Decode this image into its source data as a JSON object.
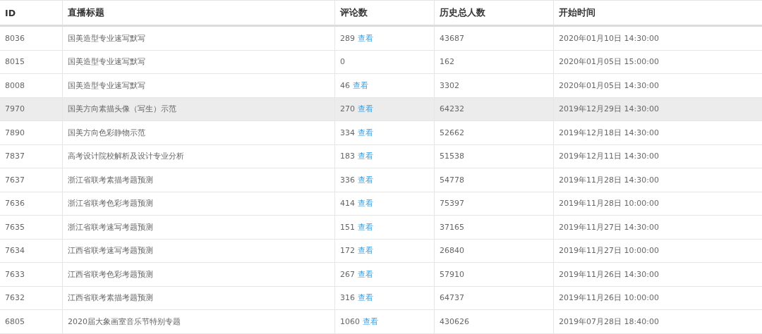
{
  "table": {
    "columns": [
      "ID",
      "直播标题",
      "评论数",
      "历史总人数",
      "开始时间"
    ],
    "rows": [
      {
        "id": "8036",
        "title": "国美造型专业速写默写",
        "comments": "289",
        "link": "查看",
        "viewers": "43687",
        "start": "2020年01月10日 14:30:00",
        "selected": false
      },
      {
        "id": "8015",
        "title": "国美造型专业速写默写",
        "comments": "0",
        "viewers": "162",
        "start": "2020年01月05日 15:00:00",
        "selected": false
      },
      {
        "id": "8008",
        "title": "国美造型专业速写默写",
        "comments": "46",
        "link": "查看",
        "viewers": "3302",
        "start": "2020年01月05日 14:30:00",
        "selected": false
      },
      {
        "id": "7970",
        "title": "国美方向素描头像（写生）示范",
        "comments": "270",
        "link": "查看",
        "viewers": "64232",
        "start": "2019年12月29日 14:30:00",
        "selected": true
      },
      {
        "id": "7890",
        "title": "国美方向色彩静物示范",
        "comments": "334",
        "link": "查看",
        "viewers": "52662",
        "start": "2019年12月18日 14:30:00",
        "selected": false
      },
      {
        "id": "7837",
        "title": "高考设计院校解析及设计专业分析",
        "comments": "183",
        "link": "查看",
        "viewers": "51538",
        "start": "2019年12月11日 14:30:00",
        "selected": false
      },
      {
        "id": "7637",
        "title": "浙江省联考素描考题预测",
        "comments": "336",
        "link": "查看",
        "viewers": "54778",
        "start": "2019年11月28日 14:30:00",
        "selected": false
      },
      {
        "id": "7636",
        "title": "浙江省联考色彩考题预测",
        "comments": "414",
        "link": "查看",
        "viewers": "75397",
        "start": "2019年11月28日 10:00:00",
        "selected": false
      },
      {
        "id": "7635",
        "title": "浙江省联考速写考题预测",
        "comments": "151",
        "link": "查看",
        "viewers": "37165",
        "start": "2019年11月27日 14:30:00",
        "selected": false
      },
      {
        "id": "7634",
        "title": "江西省联考速写考题预测",
        "comments": "172",
        "link": "查看",
        "viewers": "26840",
        "start": "2019年11月27日 10:00:00",
        "selected": false
      },
      {
        "id": "7633",
        "title": "江西省联考色彩考题预测",
        "comments": "267",
        "link": "查看",
        "viewers": "57910",
        "start": "2019年11月26日 14:30:00",
        "selected": false
      },
      {
        "id": "7632",
        "title": "江西省联考素描考题预测",
        "comments": "316",
        "link": "查看",
        "viewers": "64737",
        "start": "2019年11月26日 10:00:00",
        "selected": false
      },
      {
        "id": "6805",
        "title": "2020届大象画室音乐节特别专题",
        "comments": "1060",
        "link": "查看",
        "viewers": "430626",
        "start": "2019年07月28日 18:40:00",
        "selected": false
      }
    ]
  }
}
